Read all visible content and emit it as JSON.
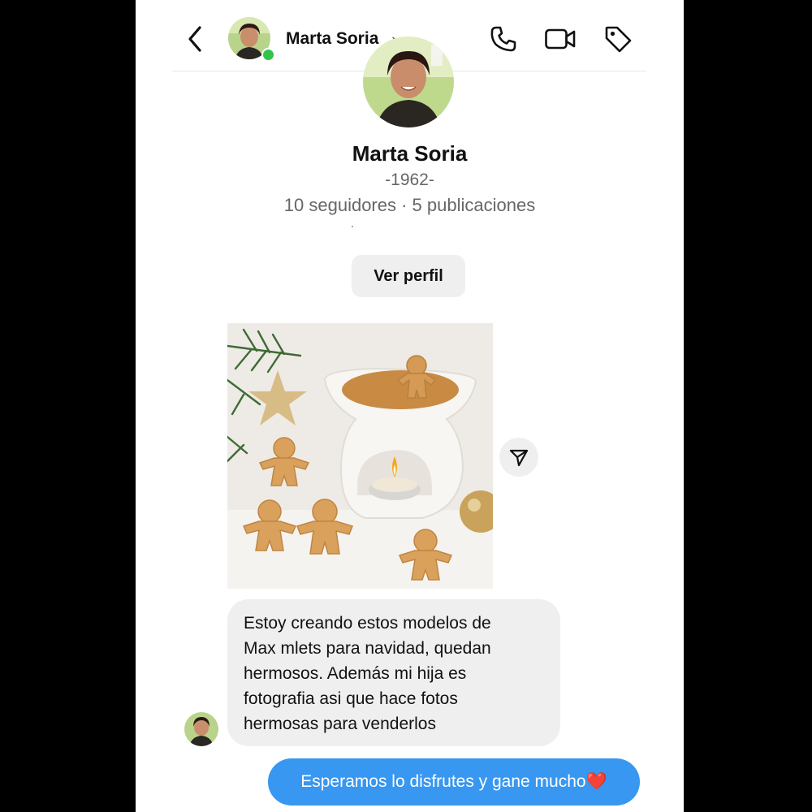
{
  "header": {
    "contact_name": "Marta Soria",
    "chevron": "›",
    "icons": [
      "back-arrow-icon",
      "phone-icon",
      "video-camera-icon",
      "tag-icon"
    ],
    "online": true
  },
  "profile": {
    "name": "Marta Soria",
    "year": "-1962-",
    "stats": "10 seguidores · 5 publicaciones",
    "view_profile_label": "Ver perfil"
  },
  "messages": [
    {
      "direction": "incoming",
      "type": "image",
      "image_content": "wax melter with candle and gingerbread wax melts"
    },
    {
      "direction": "incoming",
      "type": "text",
      "lines": [
        "Estoy creando estos modelos de",
        "Max mlets para navidad, quedan",
        "hermosos. Además mi hija es",
        "fotografia asi que hace fotos",
        "hermosas para venderlos"
      ]
    },
    {
      "direction": "outgoing",
      "type": "text",
      "text": "Esperamos lo disfrutes y gane mucho❤️"
    }
  ],
  "colors": {
    "outgoing_bubble": "#3897f0",
    "incoming_bubble": "#efefef",
    "online_dot": "#31c44c"
  }
}
